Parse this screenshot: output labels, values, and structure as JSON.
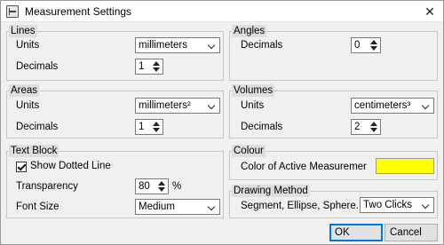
{
  "window": {
    "title": "Measurement Settings",
    "close": "✕"
  },
  "lines": {
    "title": "Lines",
    "units_label": "Units",
    "units_value": "millimeters",
    "decimals_label": "Decimals",
    "decimals_value": "1"
  },
  "angles": {
    "title": "Angles",
    "decimals_label": "Decimals",
    "decimals_value": "0"
  },
  "areas": {
    "title": "Areas",
    "units_label": "Units",
    "units_value": "millimeters²",
    "decimals_label": "Decimals",
    "decimals_value": "1"
  },
  "volumes": {
    "title": "Volumes",
    "units_label": "Units",
    "units_value": "centimeters³",
    "decimals_label": "Decimals",
    "decimals_value": "2"
  },
  "text_block": {
    "title": "Text Block",
    "show_dotted_line_label": "Show Dotted Line",
    "show_dotted_line_checked": true,
    "transparency_label": "Transparency",
    "transparency_value": "80",
    "transparency_unit": "%",
    "font_size_label": "Font Size",
    "font_size_value": "Medium"
  },
  "colour": {
    "title": "Colour",
    "active_label": "Color of Active Measuremer",
    "active_color": "#ffff00"
  },
  "drawing_method": {
    "title": "Drawing Method",
    "shapes_label": "Segment, Ellipse, Sphere...",
    "method_value": "Two Clicks"
  },
  "buttons": {
    "ok": "OK",
    "cancel": "Cancel"
  }
}
